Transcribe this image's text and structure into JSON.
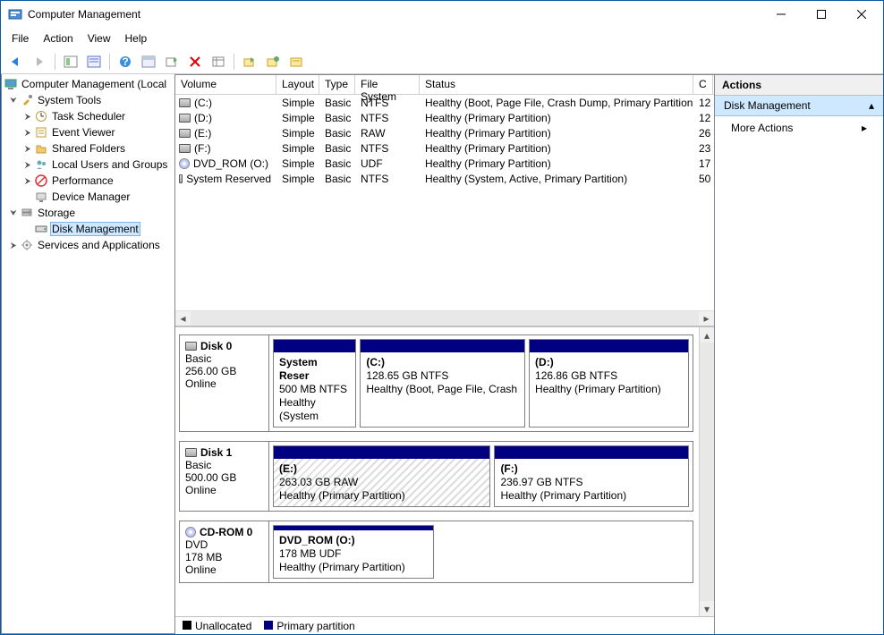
{
  "window": {
    "title": "Computer Management"
  },
  "menubar": [
    "File",
    "Action",
    "View",
    "Help"
  ],
  "tree": {
    "root": "Computer Management (Local",
    "system_tools": "System Tools",
    "task_scheduler": "Task Scheduler",
    "event_viewer": "Event Viewer",
    "shared_folders": "Shared Folders",
    "local_users": "Local Users and Groups",
    "performance": "Performance",
    "device_manager": "Device Manager",
    "storage": "Storage",
    "disk_management": "Disk Management",
    "services": "Services and Applications"
  },
  "columns": {
    "volume": "Volume",
    "layout": "Layout",
    "type": "Type",
    "fs": "File System",
    "status": "Status",
    "cap": "C"
  },
  "volumes": [
    {
      "name": "(C:)",
      "icon": "drive",
      "layout": "Simple",
      "type": "Basic",
      "fs": "NTFS",
      "status": "Healthy (Boot, Page File, Crash Dump, Primary Partition)",
      "cap": "12"
    },
    {
      "name": "(D:)",
      "icon": "drive",
      "layout": "Simple",
      "type": "Basic",
      "fs": "NTFS",
      "status": "Healthy (Primary Partition)",
      "cap": "12"
    },
    {
      "name": "(E:)",
      "icon": "drive",
      "layout": "Simple",
      "type": "Basic",
      "fs": "RAW",
      "status": "Healthy (Primary Partition)",
      "cap": "26"
    },
    {
      "name": "(F:)",
      "icon": "drive",
      "layout": "Simple",
      "type": "Basic",
      "fs": "NTFS",
      "status": "Healthy (Primary Partition)",
      "cap": "23"
    },
    {
      "name": "DVD_ROM (O:)",
      "icon": "dvd",
      "layout": "Simple",
      "type": "Basic",
      "fs": "UDF",
      "status": "Healthy (Primary Partition)",
      "cap": "17"
    },
    {
      "name": "System Reserved",
      "icon": "drive",
      "layout": "Simple",
      "type": "Basic",
      "fs": "NTFS",
      "status": "Healthy (System, Active, Primary Partition)",
      "cap": "50"
    }
  ],
  "disks": [
    {
      "name": "Disk 0",
      "icon": "drive",
      "type": "Basic",
      "size": "256.00 GB",
      "state": "Online",
      "parts": [
        {
          "label": "System Reser",
          "line2": "500 MB NTFS",
          "line3": "Healthy (System",
          "flex": "0.8"
        },
        {
          "label": "(C:)",
          "line2": "128.65 GB NTFS",
          "line3": "Healthy (Boot, Page File, Crash",
          "flex": "1.6"
        },
        {
          "label": "(D:)",
          "line2": "126.86 GB NTFS",
          "line3": "Healthy (Primary Partition)",
          "flex": "1.55"
        }
      ]
    },
    {
      "name": "Disk 1",
      "icon": "drive",
      "type": "Basic",
      "size": "500.00 GB",
      "state": "Online",
      "parts": [
        {
          "label": "(E:)",
          "line2": "263.03 GB RAW",
          "line3": "Healthy (Primary Partition)",
          "flex": "1.12",
          "hatched": true
        },
        {
          "label": "(F:)",
          "line2": "236.97 GB NTFS",
          "line3": "Healthy (Primary Partition)",
          "flex": "1"
        }
      ]
    },
    {
      "name": "CD-ROM 0",
      "icon": "dvd",
      "type": "DVD",
      "size": "178 MB",
      "state": "Online",
      "parts": [
        {
          "label": "DVD_ROM  (O:)",
          "line2": "178 MB UDF",
          "line3": "Healthy (Primary Partition)",
          "flex": "1",
          "narrow": true
        }
      ]
    }
  ],
  "legend": {
    "unalloc": "Unallocated",
    "primary": "Primary partition"
  },
  "actions": {
    "header": "Actions",
    "sel": "Disk Management",
    "more": "More Actions"
  }
}
